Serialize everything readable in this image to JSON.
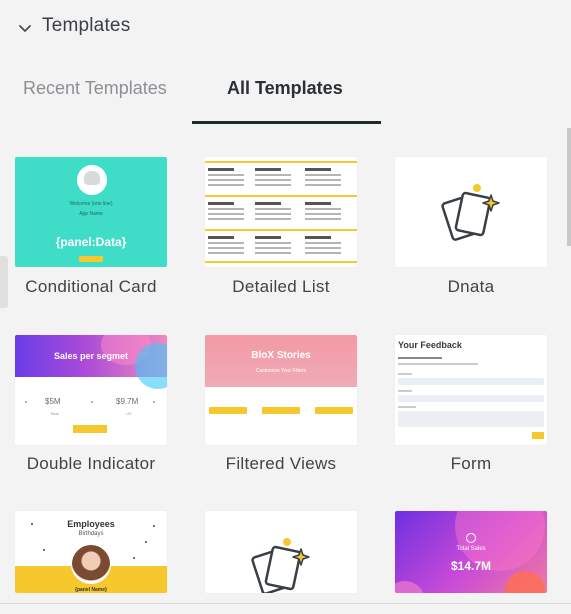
{
  "section": {
    "title": "Templates",
    "expanded": true
  },
  "tabs": [
    {
      "label": "Recent Templates",
      "active": false
    },
    {
      "label": "All Templates",
      "active": true
    }
  ],
  "colors": {
    "teal": "#3fdcc8",
    "accent_yellow": "#f7c82e",
    "tab_underline": "#1d2a2a"
  },
  "templates": [
    {
      "label": "Conditional Card",
      "preview": {
        "small_text_1": "Welcome (one line)",
        "small_text_2": "App Name",
        "big_text": "{panel:Data}"
      }
    },
    {
      "label": "Detailed List",
      "preview": {
        "col_1": "Name Admin",
        "col_2": "Profile",
        "col_3": "Activity",
        "row_2_name": "Name Campbell",
        "row_3_name": "Name Campbell"
      }
    },
    {
      "label": "Dnata",
      "preview": {
        "icon": "cards-sparkle-icon"
      }
    },
    {
      "label": "Double Indicator",
      "preview": {
        "title": "Sales per segmet",
        "value_1": "$5M",
        "value_2": "$9.7M",
        "sub_1": "Blue",
        "sub_2": "US"
      }
    },
    {
      "label": "Filtered Views",
      "preview": {
        "title": "BloX Stories",
        "subtitle": "Customize Your Filters"
      }
    },
    {
      "label": "Form",
      "preview": {
        "title": "Your Feedback",
        "line": "Please fill out the form below"
      }
    },
    {
      "label": "",
      "preview": {
        "title": "Employees",
        "subtitle": "Birthdays",
        "name": "{panel Name}"
      }
    },
    {
      "label": "",
      "preview": {
        "icon": "cards-sparkle-icon"
      }
    },
    {
      "label": "",
      "preview": {
        "title": "Total Sales",
        "value": "$14.7M"
      }
    }
  ]
}
